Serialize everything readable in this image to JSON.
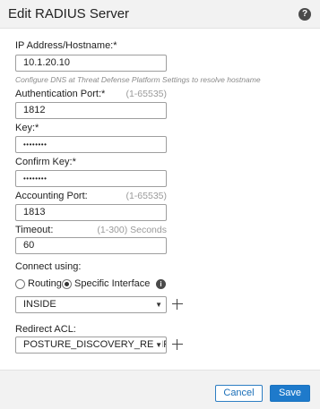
{
  "dialog": {
    "title": "Edit RADIUS Server",
    "help_icon": "question-circle-icon"
  },
  "form": {
    "ip_address": {
      "label": "IP Address/Hostname:*",
      "value": "10.1.20.10",
      "helper": "Configure DNS at Threat Defense Platform Settings to resolve hostname"
    },
    "auth_port": {
      "label": "Authentication Port:*",
      "range": "(1-65535)",
      "value": "1812"
    },
    "key": {
      "label": "Key:*",
      "value": "••••••••"
    },
    "confirm_key": {
      "label": "Confirm Key:*",
      "value": "••••••••"
    },
    "accounting_port": {
      "label": "Accounting Port:",
      "range": "(1-65535)",
      "value": "1813"
    },
    "timeout": {
      "label": "Timeout:",
      "range": "(1-300) Seconds",
      "value": "60"
    },
    "connect_using": {
      "label": "Connect using:",
      "options": [
        "Routing",
        "Specific Interface"
      ],
      "selected": "Specific Interface",
      "info_icon": "info-circle-icon"
    },
    "interface": {
      "value": "INSIDE"
    },
    "redirect_acl": {
      "label": "Redirect ACL:",
      "value": "POSTURE_DISCOVERY_REDIRECT"
    }
  },
  "footer": {
    "cancel_label": "Cancel",
    "save_label": "Save"
  },
  "colors": {
    "primary": "#1e7acb",
    "header_bg": "#f2f2f2"
  }
}
